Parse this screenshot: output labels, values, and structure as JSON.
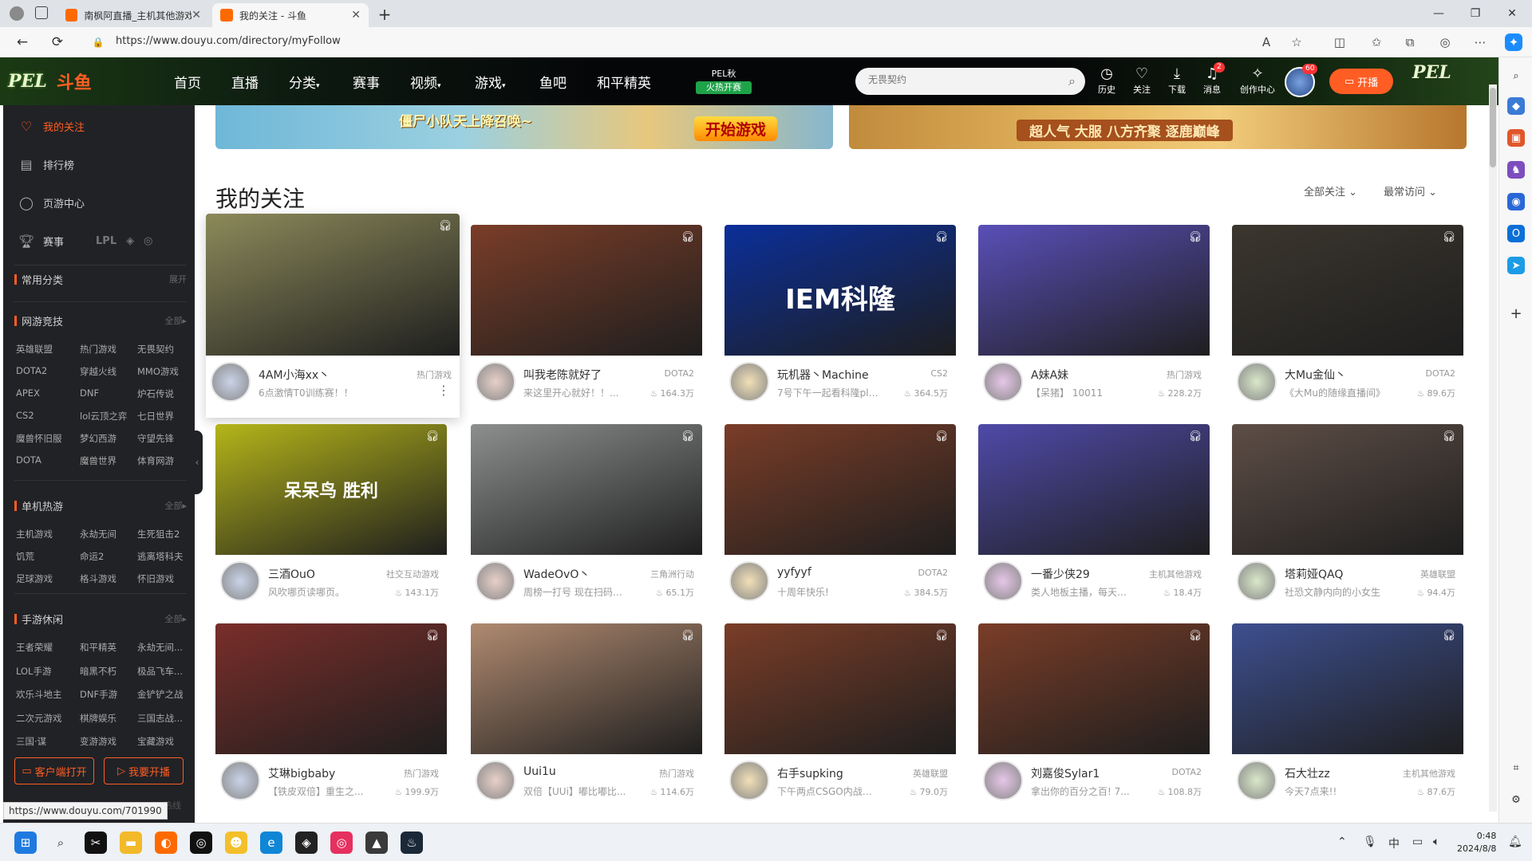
{
  "browser": {
    "tabs": [
      {
        "title": "南枫阿直播_主机其他游戏直播..."
      },
      {
        "title": "我的关注 - 斗鱼"
      }
    ],
    "url": "https://www.douyu.com/directory/myFollow"
  },
  "header": {
    "nav": [
      "首页",
      "直播",
      "分类",
      "赛事",
      "视频",
      "游戏",
      "鱼吧",
      "和平精英"
    ],
    "pel_label": "PEL秋",
    "pel_hot": "火热开赛",
    "search_placeholder": "无畏契约",
    "icons": [
      {
        "name": "history",
        "label": "历史"
      },
      {
        "name": "follow",
        "label": "关注"
      },
      {
        "name": "download",
        "label": "下载"
      },
      {
        "name": "message",
        "label": "消息",
        "badge": "2"
      },
      {
        "name": "creator",
        "label": "创作中心"
      }
    ],
    "avatar_badge": "60",
    "start_live": "开播"
  },
  "sidebar": {
    "items": [
      {
        "label": "我的关注",
        "icon": "heart-icon"
      },
      {
        "label": "排行榜",
        "icon": "rank-icon"
      },
      {
        "label": "页游中心",
        "icon": "game-center-icon"
      },
      {
        "label": "赛事",
        "icon": "trophy-icon"
      }
    ],
    "common": {
      "title": "常用分类",
      "more": "展开"
    },
    "sections": [
      {
        "title": "网游竞技",
        "more": "全部",
        "items": [
          "英雄联盟",
          "热门游戏",
          "无畏契约",
          "DOTA2",
          "穿越火线",
          "MMO游戏",
          "APEX",
          "DNF",
          "炉石传说",
          "CS2",
          "lol云顶之弈",
          "七日世界",
          "魔兽怀旧服",
          "梦幻西游",
          "守望先锋",
          "DOTA",
          "魔兽世界",
          "体育网游"
        ]
      },
      {
        "title": "单机热游",
        "more": "全部",
        "items": [
          "主机游戏",
          "永劫无间",
          "生死狙击2",
          "饥荒",
          "命运2",
          "逃离塔科夫",
          "足球游戏",
          "格斗游戏",
          "怀旧游戏"
        ]
      },
      {
        "title": "手游休闲",
        "more": "全部",
        "items": [
          "王者荣耀",
          "和平精英",
          "永劫无间...",
          "LOL手游",
          "暗黑不朽",
          "极品飞车...",
          "欢乐斗地主",
          "DNF手游",
          "金铲铲之战",
          "二次元游戏",
          "棋牌娱乐",
          "三国志战...",
          "三国·谋",
          "变游游戏",
          "宝藏游戏"
        ]
      }
    ],
    "buttons": {
      "client": "客户端打开",
      "live": "我要开播"
    },
    "footer_partial": "345热线"
  },
  "banners": [
    {
      "text": "僵尸小队天上降召唤~",
      "button": "开始游戏"
    },
    {
      "text": "超人气 大服 八方齐聚 逐鹿巅峰"
    }
  ],
  "main": {
    "title": "我的关注",
    "filters": [
      "全部关注",
      "最常访问"
    ],
    "cards": [
      {
        "name": "4AM小海xx丶",
        "category": "热门游戏",
        "title": "6点激情T0训练赛！！",
        "hot": "",
        "bg": "#8c8a5a",
        "caption": ""
      },
      {
        "name": "叫我老陈就好了",
        "category": "DOTA2",
        "title": "来这里开心就好！！...",
        "hot": "164.3万",
        "bg": "#7a3d28",
        "caption": ""
      },
      {
        "name": "玩机器丶Machine",
        "category": "CS2",
        "title": "7号下午一起看科隆pla...",
        "hot": "364.5万",
        "bg": "#0b2f9a",
        "caption": "IEM科隆"
      },
      {
        "name": "A妹A妹",
        "category": "热门游戏",
        "title": "【呆猪】 10011",
        "hot": "228.2万",
        "bg": "#5a4fb8",
        "caption": ""
      },
      {
        "name": "大Mu金仙丶",
        "category": "DOTA2",
        "title": "《大Mu的随缘直播间》",
        "hot": "89.6万",
        "bg": "#3b362e",
        "caption": ""
      },
      {
        "name": "三酒OuO",
        "category": "社交互动游戏",
        "title": "风吹哪页读哪页。",
        "hot": "143.1万",
        "bg": "#b5b51a",
        "caption": "呆呆鸟 胜利"
      },
      {
        "name": "WadeOvO丶",
        "category": "三角洲行动",
        "title": "周榜一打号 现在扫码打...",
        "hot": "65.1万",
        "bg": "#8d8f8f",
        "caption": ""
      },
      {
        "name": "yyfyyf",
        "category": "DOTA2",
        "title": "十周年快乐!",
        "hot": "384.5万",
        "bg": "#7a3d28",
        "caption": ""
      },
      {
        "name": "一番少侠29",
        "category": "主机其他游戏",
        "title": "类人地板主播，每天都...",
        "hot": "18.4万",
        "bg": "#4f4aa8",
        "caption": ""
      },
      {
        "name": "塔莉娅QAQ",
        "category": "英雄联盟",
        "title": "社恐文静内向的小女生",
        "hot": "94.4万",
        "bg": "#5e4e46",
        "caption": ""
      },
      {
        "name": "艾琳bigbaby",
        "category": "热门游戏",
        "title": "【铁皮双倍】重生之...",
        "hot": "199.9万",
        "bg": "#7a2e2a",
        "caption": ""
      },
      {
        "name": "Uui1u",
        "category": "热门游戏",
        "title": "双倍【UUi】嘟比嘟比...",
        "hot": "114.6万",
        "bg": "#b08a70",
        "caption": ""
      },
      {
        "name": "右手supking",
        "category": "英雄联盟",
        "title": "下午两点CSGO内战，...",
        "hot": "79.0万",
        "bg": "#7a3d28",
        "caption": ""
      },
      {
        "name": "刘嘉俊Sylar1",
        "category": "DOTA2",
        "title": "拿出你的百分之百! 7...",
        "hot": "108.8万",
        "bg": "#7a3d28",
        "caption": ""
      },
      {
        "name": "石大壮zz",
        "category": "主机其他游戏",
        "title": "今天7点来!!",
        "hot": "87.6万",
        "bg": "#3d4f8f",
        "caption": ""
      }
    ]
  },
  "status_url": "https://www.douyu.com/701990",
  "taskbar": {
    "time": "0:48",
    "date": "2024/8/8",
    "ime": "中"
  }
}
